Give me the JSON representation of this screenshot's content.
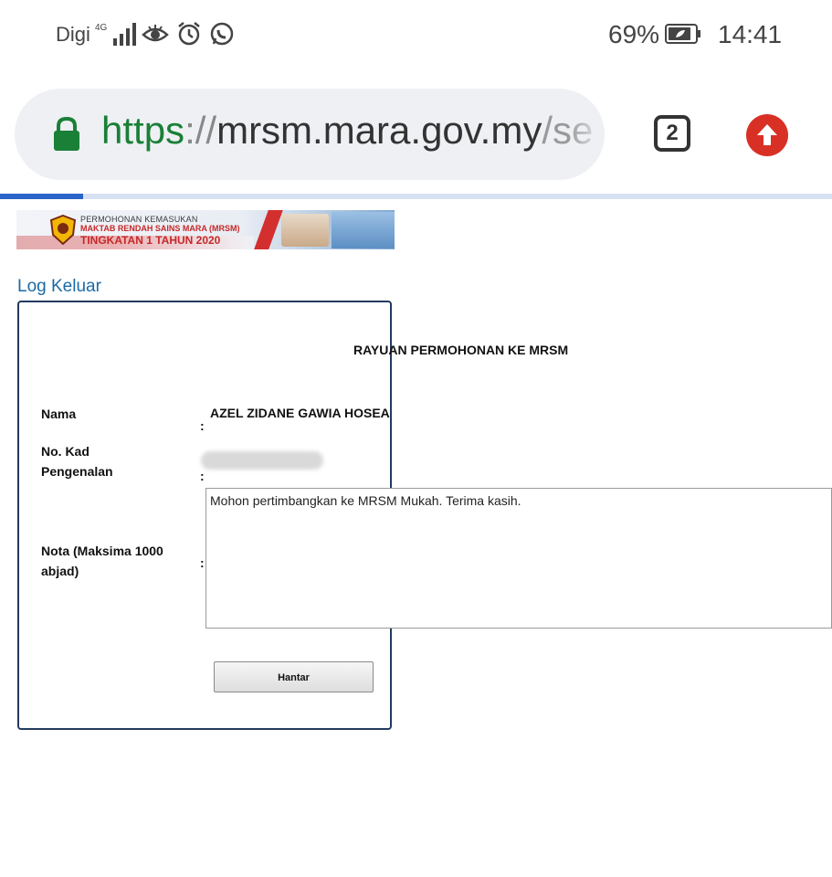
{
  "status_bar": {
    "carrier": "Digi",
    "network": "4G",
    "battery": "69%",
    "time": "14:41"
  },
  "browser": {
    "url_scheme": "https",
    "url_sep": "://",
    "url_host": "mrsm.mara.gov.my",
    "url_path": "/se",
    "tab_count": "2"
  },
  "banner": {
    "line1": "PERMOHONAN KEMASUKAN",
    "line2": "MAKTAB RENDAH SAINS MARA (MRSM)",
    "line3": "TINGKATAN 1 TAHUN 2020"
  },
  "nav": {
    "logout": "Log Keluar"
  },
  "form": {
    "title": "RAYUAN PERMOHONAN KE MRSM",
    "name_label": "Nama",
    "name_value": "AZEL ZIDANE GAWIA HOSEA",
    "ic_label_1": "No. Kad",
    "ic_label_2": "Pengenalan",
    "nota_label_1": "Nota (Maksima 1000",
    "nota_label_2": "abjad)",
    "colon": ":",
    "nota_value": "Mohon pertimbangkan ke MRSM Mukah. Terima kasih.",
    "submit": "Hantar"
  },
  "colors": {
    "link": "#1b6aa5",
    "secure": "#1a7f37",
    "alert": "#d93025",
    "border": "#223a5e"
  }
}
